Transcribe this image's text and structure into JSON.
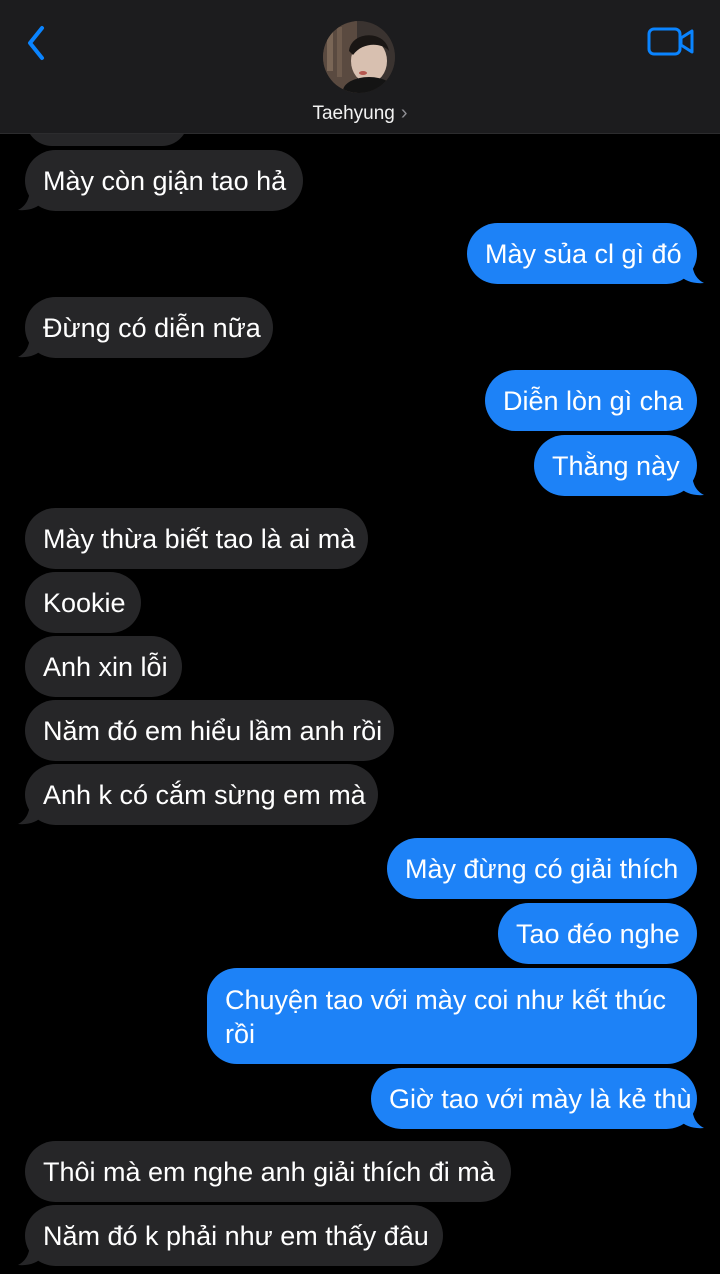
{
  "header": {
    "contact_name": "Taehyung",
    "back_icon": "chevron-left-icon",
    "video_icon": "video-camera-icon",
    "accent_color": "#0a84ff"
  },
  "colors": {
    "incoming": "#262628",
    "outgoing": "#1d82f7",
    "background": "#000000"
  },
  "messages": [
    {
      "from": "them",
      "text": "Mày còn giận tao hả"
    },
    {
      "from": "me",
      "text": "Mày sủa cl gì đó"
    },
    {
      "from": "them",
      "text": "Đừng có diễn nữa"
    },
    {
      "from": "me",
      "text": "Diễn lòn gì cha"
    },
    {
      "from": "me",
      "text": "Thằng này"
    },
    {
      "from": "them",
      "text": "Mày thừa biết tao là ai mà"
    },
    {
      "from": "them",
      "text": "Kookie"
    },
    {
      "from": "them",
      "text": "Anh xin lỗi"
    },
    {
      "from": "them",
      "text": "Năm đó em hiểu lầm anh rồi"
    },
    {
      "from": "them",
      "text": "Anh k có cắm sừng em mà"
    },
    {
      "from": "me",
      "text": "Mày đừng có giải thích"
    },
    {
      "from": "me",
      "text": "Tao đéo nghe"
    },
    {
      "from": "me",
      "text": "Chuyện tao với mày coi như kết thúc rồi"
    },
    {
      "from": "me",
      "text": "Giờ tao với mày là kẻ thù"
    },
    {
      "from": "them",
      "text": "Thôi mà em nghe anh giải thích đi mà"
    },
    {
      "from": "them",
      "text": "Năm đó k phải như em thấy đâu"
    }
  ]
}
